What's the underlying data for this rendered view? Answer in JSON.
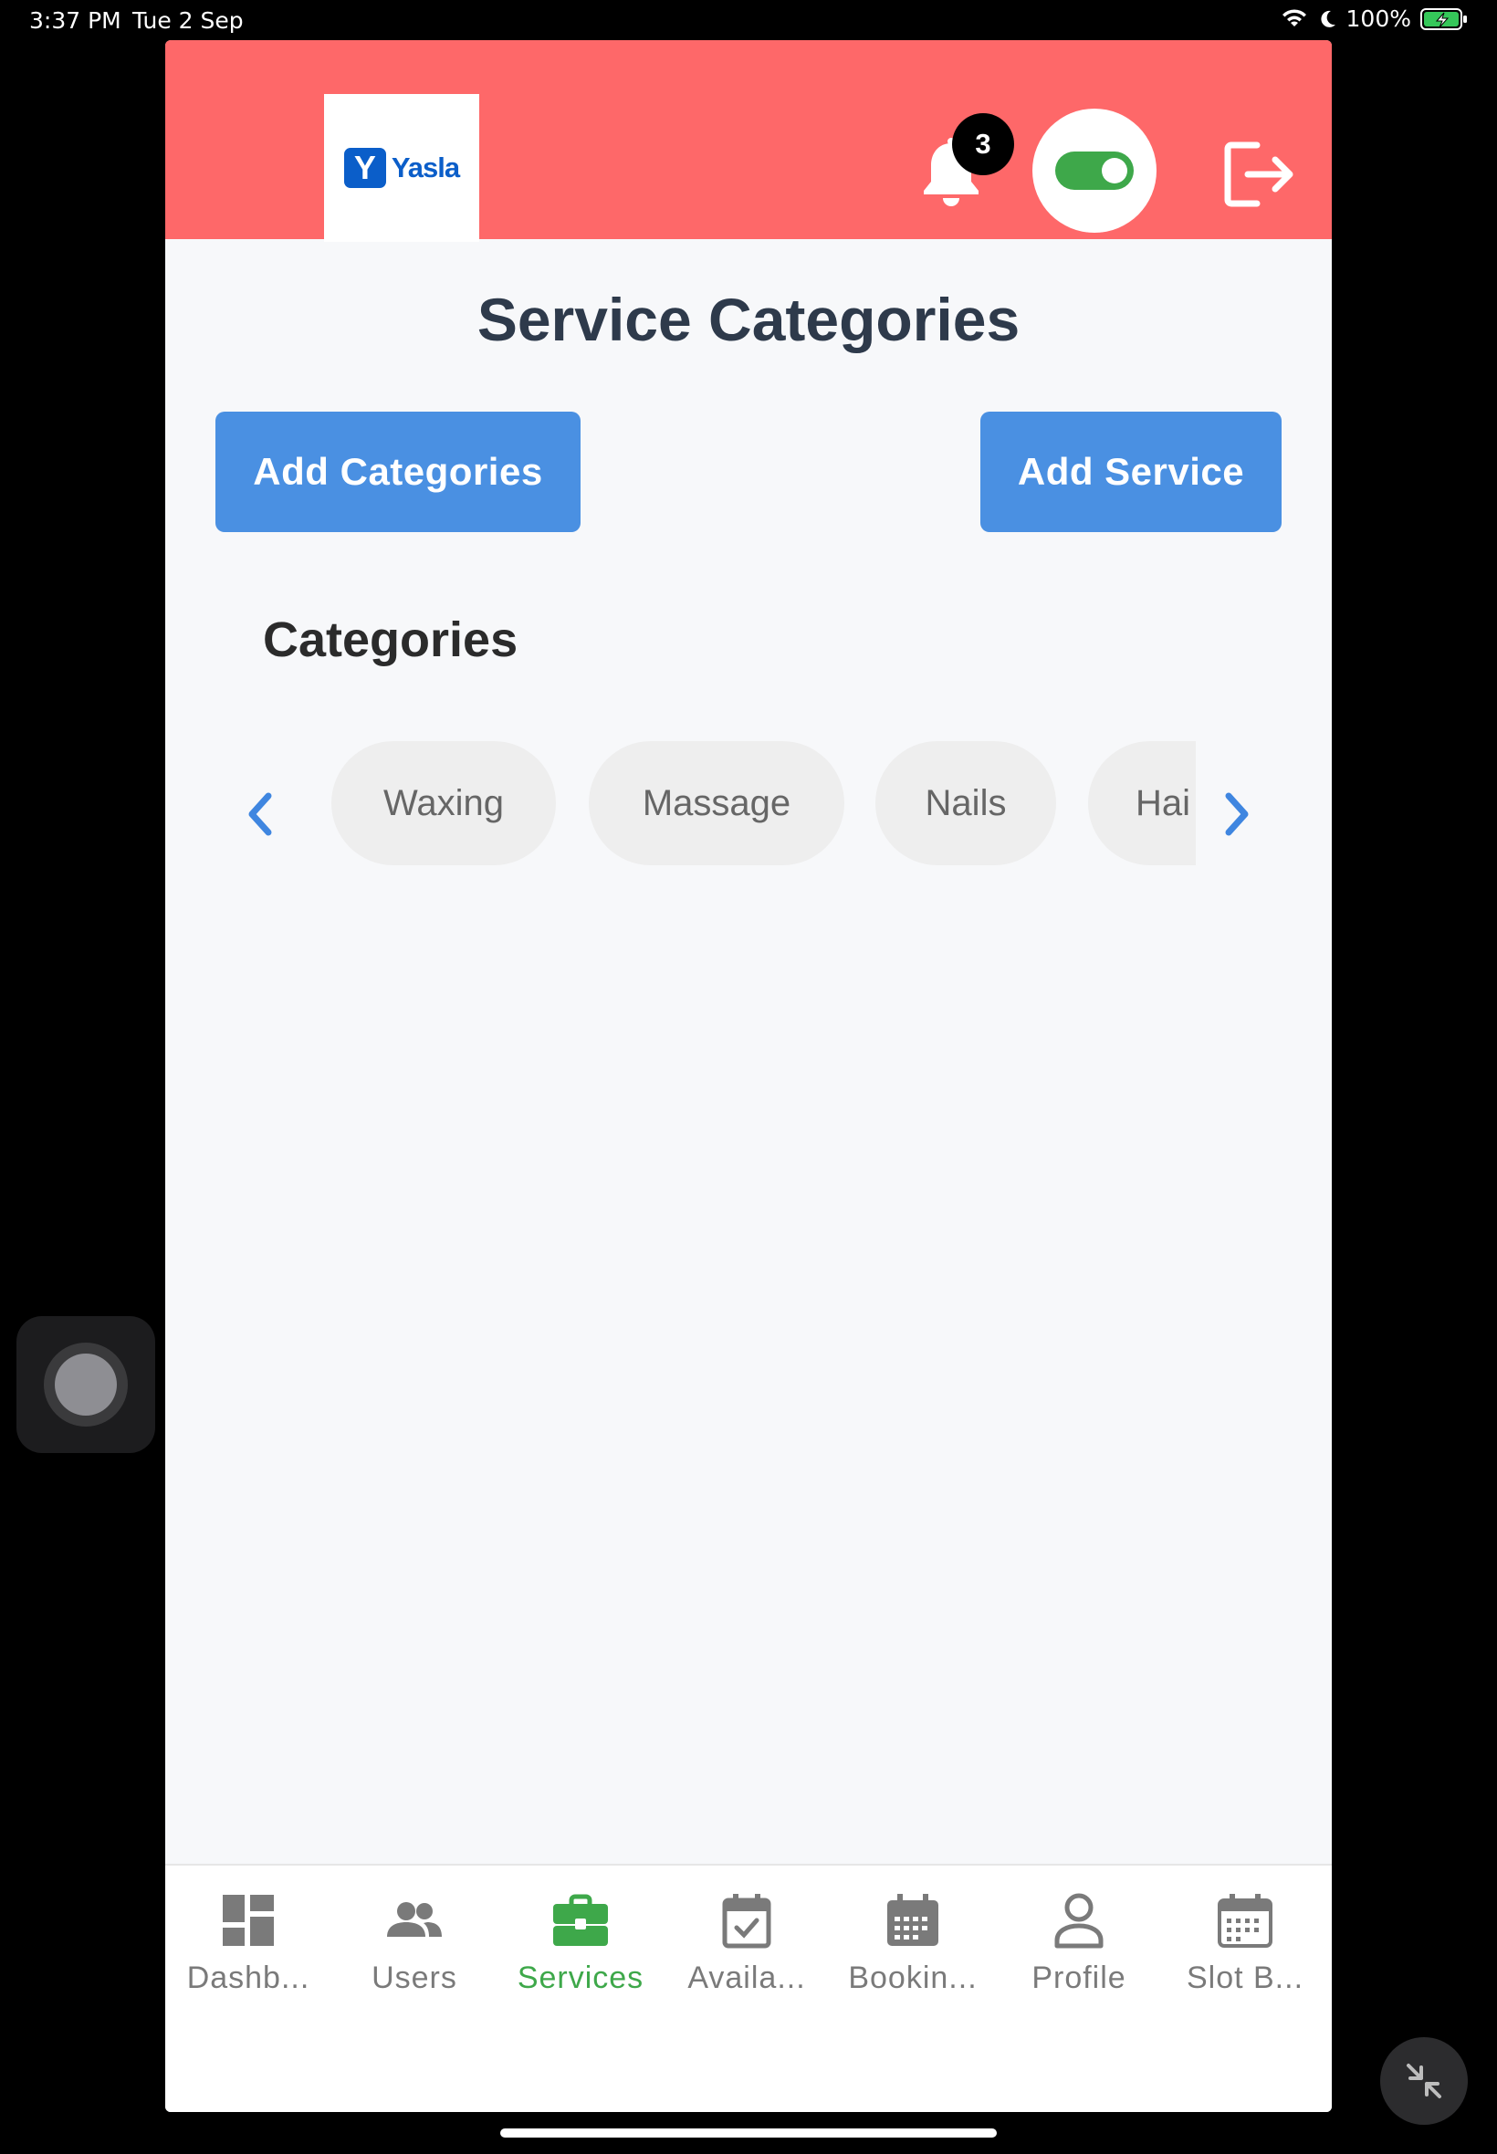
{
  "status_bar": {
    "time": "3:37 PM",
    "date": "Tue 2 Sep",
    "battery": "100%"
  },
  "header": {
    "logo_letter": "Y",
    "logo_text": "Yasla",
    "notification_count": "3",
    "toggle_on": true,
    "colors": {
      "header_bg": "#fe6869",
      "toggle": "#3ea84a"
    }
  },
  "page": {
    "title": "Service Categories",
    "add_categories_label": "Add Categories",
    "add_service_label": "Add Service",
    "categories_heading": "Categories",
    "categories": [
      "Waxing",
      "Massage",
      "Nails",
      "Hai"
    ]
  },
  "tabbar": {
    "active": "Services",
    "items": [
      {
        "label": "Dashb...",
        "icon": "dashboard-icon"
      },
      {
        "label": "Users",
        "icon": "users-icon"
      },
      {
        "label": "Services",
        "icon": "briefcase-icon"
      },
      {
        "label": "Availa...",
        "icon": "calendar-check-icon"
      },
      {
        "label": "Bookin...",
        "icon": "calendar-grid-icon"
      },
      {
        "label": "Profile",
        "icon": "person-icon"
      },
      {
        "label": "Slot B...",
        "icon": "calendar-dots-icon"
      }
    ]
  }
}
